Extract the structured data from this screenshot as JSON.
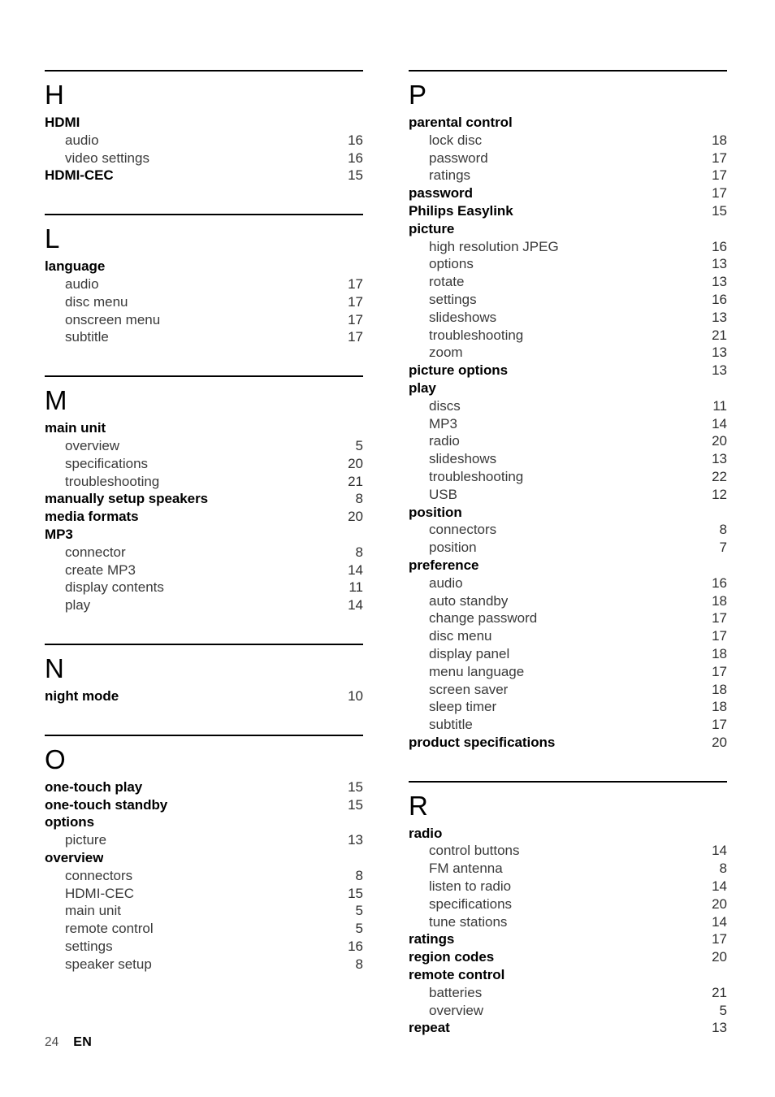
{
  "document": {
    "title": "Index",
    "footer": {
      "page_number": "24",
      "language_code": "EN"
    }
  },
  "columns": [
    {
      "name": "left-column",
      "sections": [
        {
          "letter": "H",
          "gap_after": 36,
          "entries": [
            {
              "label": "HDMI",
              "page": "",
              "level": 0
            },
            {
              "label": "audio",
              "page": "16",
              "level": 1
            },
            {
              "label": "video settings",
              "page": "16",
              "level": 1
            },
            {
              "label": "HDMI-CEC",
              "page": "15",
              "level": 0
            }
          ]
        },
        {
          "letter": "L",
          "gap_after": 36,
          "entries": [
            {
              "label": "language",
              "page": "",
              "level": 0
            },
            {
              "label": "audio",
              "page": "17",
              "level": 1
            },
            {
              "label": "disc menu",
              "page": "17",
              "level": 1
            },
            {
              "label": "onscreen menu",
              "page": "17",
              "level": 1
            },
            {
              "label": "subtitle",
              "page": "17",
              "level": 1
            }
          ]
        },
        {
          "letter": "M",
          "gap_after": 36,
          "entries": [
            {
              "label": "main unit",
              "page": "",
              "level": 0
            },
            {
              "label": "overview",
              "page": "5",
              "level": 1
            },
            {
              "label": "specifications",
              "page": "20",
              "level": 1
            },
            {
              "label": "troubleshooting",
              "page": "21",
              "level": 1
            },
            {
              "label": "manually setup speakers",
              "page": "8",
              "level": 0
            },
            {
              "label": "media formats",
              "page": "20",
              "level": 0
            },
            {
              "label": "MP3",
              "page": "",
              "level": 0
            },
            {
              "label": "connector",
              "page": "8",
              "level": 1
            },
            {
              "label": "create MP3",
              "page": "14",
              "level": 1
            },
            {
              "label": "display contents",
              "page": "11",
              "level": 1
            },
            {
              "label": "play",
              "page": "14",
              "level": 1
            }
          ]
        },
        {
          "letter": "N",
          "gap_after": 36,
          "entries": [
            {
              "label": "night mode",
              "page": "10",
              "level": 0
            }
          ]
        },
        {
          "letter": "O",
          "gap_after": 0,
          "entries": [
            {
              "label": "one-touch play",
              "page": "15",
              "level": 0
            },
            {
              "label": "one-touch standby",
              "page": "15",
              "level": 0
            },
            {
              "label": "options",
              "page": "",
              "level": 0
            },
            {
              "label": "picture",
              "page": "13",
              "level": 1
            },
            {
              "label": "overview",
              "page": "",
              "level": 0
            },
            {
              "label": "connectors",
              "page": "8",
              "level": 1
            },
            {
              "label": "HDMI-CEC",
              "page": "15",
              "level": 1
            },
            {
              "label": "main unit",
              "page": "5",
              "level": 1
            },
            {
              "label": "remote control",
              "page": "5",
              "level": 1
            },
            {
              "label": "settings",
              "page": "16",
              "level": 1
            },
            {
              "label": "speaker setup",
              "page": "8",
              "level": 1
            }
          ]
        }
      ]
    },
    {
      "name": "right-column",
      "sections": [
        {
          "letter": "P",
          "gap_after": 36,
          "entries": [
            {
              "label": "parental control",
              "page": "",
              "level": 0
            },
            {
              "label": "lock disc",
              "page": "18",
              "level": 1
            },
            {
              "label": "password",
              "page": "17",
              "level": 1
            },
            {
              "label": "ratings",
              "page": "17",
              "level": 1
            },
            {
              "label": "password",
              "page": "17",
              "level": 0
            },
            {
              "label": "Philips Easylink",
              "page": "15",
              "level": 0
            },
            {
              "label": "picture",
              "page": "",
              "level": 0
            },
            {
              "label": "high resolution JPEG",
              "page": "16",
              "level": 1
            },
            {
              "label": "options",
              "page": "13",
              "level": 1
            },
            {
              "label": "rotate",
              "page": "13",
              "level": 1
            },
            {
              "label": "settings",
              "page": "16",
              "level": 1
            },
            {
              "label": "slideshows",
              "page": "13",
              "level": 1
            },
            {
              "label": "troubleshooting",
              "page": "21",
              "level": 1
            },
            {
              "label": "zoom",
              "page": "13",
              "level": 1
            },
            {
              "label": "picture options",
              "page": "13",
              "level": 0
            },
            {
              "label": "play",
              "page": "",
              "level": 0
            },
            {
              "label": "discs",
              "page": "11",
              "level": 1
            },
            {
              "label": "MP3",
              "page": "14",
              "level": 1
            },
            {
              "label": "radio",
              "page": "20",
              "level": 1
            },
            {
              "label": "slideshows",
              "page": "13",
              "level": 1
            },
            {
              "label": "troubleshooting",
              "page": "22",
              "level": 1
            },
            {
              "label": "USB",
              "page": "12",
              "level": 1
            },
            {
              "label": "position",
              "page": "",
              "level": 0
            },
            {
              "label": "connectors",
              "page": "8",
              "level": 1
            },
            {
              "label": "position",
              "page": "7",
              "level": 1
            },
            {
              "label": "preference",
              "page": "",
              "level": 0
            },
            {
              "label": "audio",
              "page": "16",
              "level": 1
            },
            {
              "label": "auto standby",
              "page": "18",
              "level": 1
            },
            {
              "label": "change password",
              "page": "17",
              "level": 1
            },
            {
              "label": "disc menu",
              "page": "17",
              "level": 1
            },
            {
              "label": "display panel",
              "page": "18",
              "level": 1
            },
            {
              "label": "menu language",
              "page": "17",
              "level": 1
            },
            {
              "label": "screen saver",
              "page": "18",
              "level": 1
            },
            {
              "label": "sleep timer",
              "page": "18",
              "level": 1
            },
            {
              "label": "subtitle",
              "page": "17",
              "level": 1
            },
            {
              "label": "product specifications",
              "page": "20",
              "level": 0
            }
          ]
        },
        {
          "letter": "R",
          "gap_after": 0,
          "entries": [
            {
              "label": "radio",
              "page": "",
              "level": 0
            },
            {
              "label": "control buttons",
              "page": "14",
              "level": 1
            },
            {
              "label": "FM antenna",
              "page": "8",
              "level": 1
            },
            {
              "label": "listen to radio",
              "page": "14",
              "level": 1
            },
            {
              "label": "specifications",
              "page": "20",
              "level": 1
            },
            {
              "label": "tune stations",
              "page": "14",
              "level": 1
            },
            {
              "label": "ratings",
              "page": "17",
              "level": 0
            },
            {
              "label": "region codes",
              "page": "20",
              "level": 0
            },
            {
              "label": "remote control",
              "page": "",
              "level": 0
            },
            {
              "label": "batteries",
              "page": "21",
              "level": 1
            },
            {
              "label": "overview",
              "page": "5",
              "level": 1
            },
            {
              "label": "repeat",
              "page": "13",
              "level": 0
            }
          ]
        }
      ]
    }
  ]
}
